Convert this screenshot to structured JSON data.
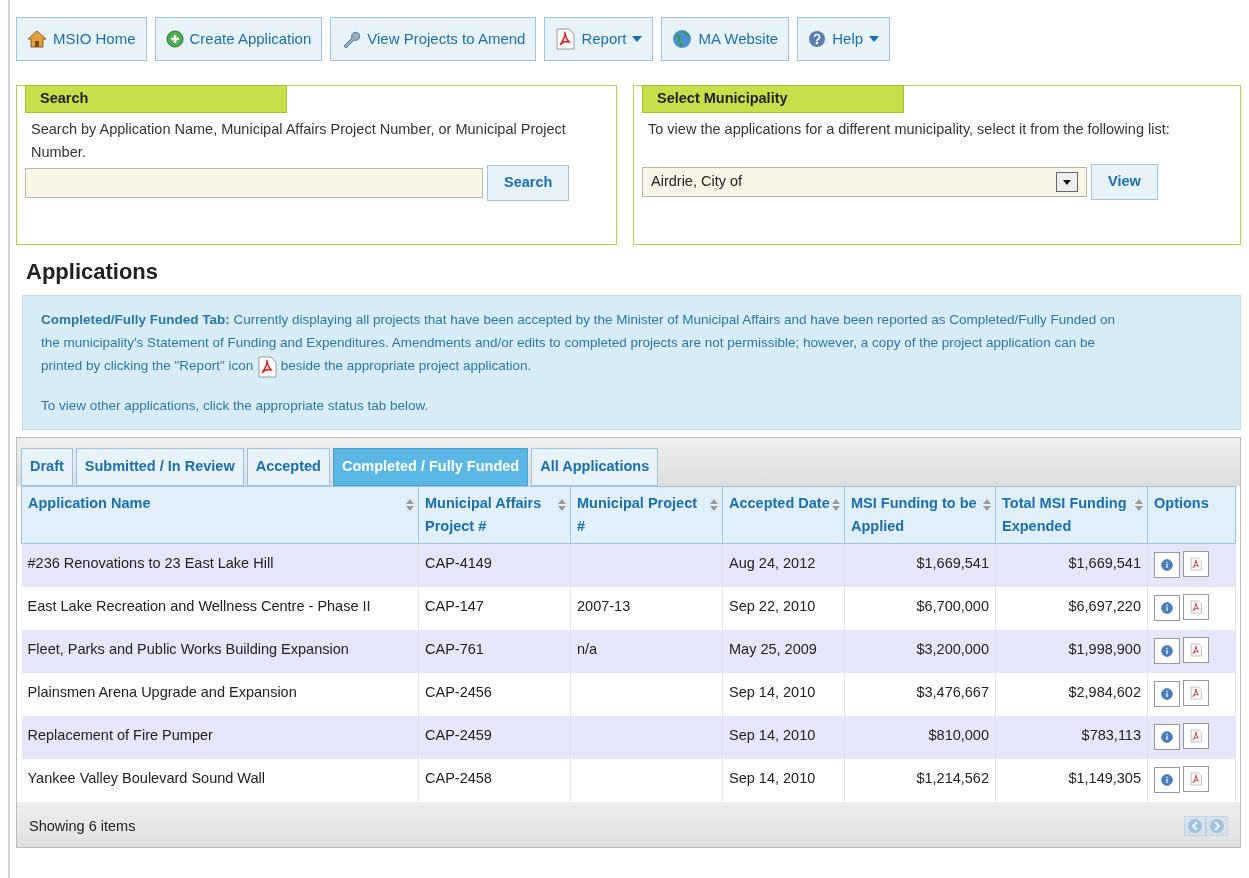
{
  "toolbar": [
    {
      "label": "MSIO Home",
      "dropdown": false
    },
    {
      "label": "Create Application",
      "dropdown": false
    },
    {
      "label": "View Projects to Amend",
      "dropdown": false
    },
    {
      "label": "Report",
      "dropdown": true
    },
    {
      "label": "MA Website",
      "dropdown": false
    },
    {
      "label": "Help",
      "dropdown": true
    }
  ],
  "search_panel": {
    "title": "Search",
    "description": "Search by Application Name, Municipal Affairs Project Number, or Municipal Project Number.",
    "button": "Search"
  },
  "municipality_panel": {
    "title": "Select Municipality",
    "description": "To view the applications for a different municipality, select it from the following list:",
    "value": "Airdrie, City of",
    "button": "View"
  },
  "heading": "Applications",
  "info": {
    "text_before": "**Completed/Fully Funded Tab:** Currently displaying all projects that have been accepted by the Minister of Municipal Affairs and have been reported as Completed/Fully Funded on the municipality's Statement of Funding and Expenditures. Amendments and/or edits to completed projects are not permissible; however, a copy of the project application can be printed by clicking the \"Report\" icon",
    "text_after": "beside the appropriate project application.",
    "note": "To view other applications, click the appropriate status tab below."
  },
  "tabs": [
    {
      "label": "Draft",
      "selected": false
    },
    {
      "label": "Submitted / In Review",
      "selected": false
    },
    {
      "label": "Accepted",
      "selected": false
    },
    {
      "label": "Completed / Fully Funded",
      "selected": true
    },
    {
      "label": "All Applications",
      "selected": false
    }
  ],
  "table": {
    "columns": [
      {
        "label": "Application Name",
        "sortable": true
      },
      {
        "label": "Municipal Affairs Project #",
        "sortable": true
      },
      {
        "label": "Municipal Project #",
        "sortable": true
      },
      {
        "label": "Accepted Date",
        "sortable": true
      },
      {
        "label": "MSI Funding to be Applied",
        "sortable": true
      },
      {
        "label": "Total MSI Funding Expended",
        "sortable": true
      },
      {
        "label": "Options",
        "sortable": false
      }
    ],
    "rows": [
      {
        "name": "#236 Renovations to 23 East Lake Hill",
        "ma_project": "CAP-4149",
        "municipal_project": "",
        "accepted": "Aug 24, 2012",
        "funding": "$1,669,541",
        "expended": "$1,669,541"
      },
      {
        "name": "East Lake Recreation and Wellness Centre - Phase II",
        "ma_project": "CAP-147",
        "municipal_project": "2007-13",
        "accepted": "Sep 22, 2010",
        "funding": "$6,700,000",
        "expended": "$6,697,220"
      },
      {
        "name": "Fleet, Parks and Public Works Building Expansion",
        "ma_project": "CAP-761",
        "municipal_project": "n/a",
        "accepted": "May 25, 2009",
        "funding": "$3,200,000",
        "expended": "$1,998,900"
      },
      {
        "name": "Plainsmen Arena Upgrade and Expansion",
        "ma_project": "CAP-2456",
        "municipal_project": "",
        "accepted": "Sep 14, 2010",
        "funding": "$3,476,667",
        "expended": "$2,984,602"
      },
      {
        "name": "Replacement of Fire Pumper",
        "ma_project": "CAP-2459",
        "municipal_project": "",
        "accepted": "Sep 14, 2010",
        "funding": "$810,000",
        "expended": "$783,113"
      },
      {
        "name": "Yankee Valley Boulevard Sound Wall",
        "ma_project": "CAP-2458",
        "municipal_project": "",
        "accepted": "Sep 14, 2010",
        "funding": "$1,214,562",
        "expended": "$1,149,305"
      }
    ]
  },
  "status_bar": "Showing 6 items"
}
